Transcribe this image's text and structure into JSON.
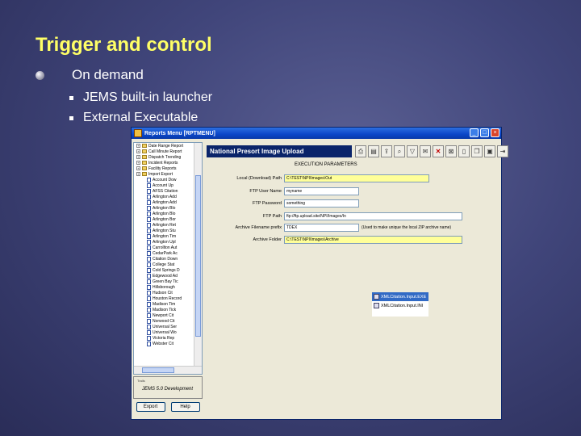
{
  "slide": {
    "title": "Trigger and control",
    "bullet": "On demand",
    "subbullets": [
      "JEMS built-in launcher",
      "External Executable"
    ]
  },
  "window": {
    "title": "Reports Menu [RPTMENU]",
    "tree_items": [
      {
        "label": "Date Range Report",
        "type": "folder"
      },
      {
        "label": "Call Minute Report",
        "type": "folder"
      },
      {
        "label": "Dispatch Trending",
        "type": "folder"
      },
      {
        "label": "Incident Reports",
        "type": "folder"
      },
      {
        "label": "Facility Reports",
        "type": "folder"
      },
      {
        "label": "Import Export",
        "type": "folder"
      },
      {
        "label": "Account Dow",
        "type": "doc"
      },
      {
        "label": "Account Up",
        "type": "doc"
      },
      {
        "label": "AFSS Citation",
        "type": "doc"
      },
      {
        "label": "Arlington Add",
        "type": "doc"
      },
      {
        "label": "Arlington Add",
        "type": "doc"
      },
      {
        "label": "Arlington Blo",
        "type": "doc"
      },
      {
        "label": "Arlington Blo",
        "type": "doc"
      },
      {
        "label": "Arlington Bor",
        "type": "doc"
      },
      {
        "label": "Arlington Ret",
        "type": "doc"
      },
      {
        "label": "Arlington Stu",
        "type": "doc"
      },
      {
        "label": "Arlington Tim",
        "type": "doc"
      },
      {
        "label": "Arlington Upl",
        "type": "doc"
      },
      {
        "label": "Carrollton Aut",
        "type": "doc"
      },
      {
        "label": "CedarPark Ac",
        "type": "doc"
      },
      {
        "label": "Citation Down",
        "type": "doc"
      },
      {
        "label": "College Stat",
        "type": "doc"
      },
      {
        "label": "Cold Springs D",
        "type": "doc"
      },
      {
        "label": "Edgewood Ad",
        "type": "doc"
      },
      {
        "label": "Green Bay Tic",
        "type": "doc"
      },
      {
        "label": "Hillsborough",
        "type": "doc"
      },
      {
        "label": "Hudson Cit",
        "type": "doc"
      },
      {
        "label": "Houston Record",
        "type": "doc"
      },
      {
        "label": "Madison Tim",
        "type": "doc"
      },
      {
        "label": "Madison Tick",
        "type": "doc"
      },
      {
        "label": "Newport Cit",
        "type": "doc"
      },
      {
        "label": "Norwood Cit",
        "type": "doc"
      },
      {
        "label": "Universal Ser",
        "type": "doc"
      },
      {
        "label": "Universal Wo",
        "type": "doc"
      },
      {
        "label": "Victoria Rep",
        "type": "doc"
      },
      {
        "label": "Webster Cit",
        "type": "doc"
      }
    ],
    "info_small": "Trails",
    "version": "JEMS 5.0 Development",
    "left_buttons": [
      "Export",
      "Help"
    ],
    "header": "National Presort Image Upload",
    "toolbar_icons": [
      "printer-icon",
      "preview-icon",
      "export-icon",
      "search-icon",
      "filter-icon",
      "email-icon",
      "delete-icon",
      "close-icon",
      "new-doc-icon",
      "copy-icon",
      "save-icon",
      "exit-icon"
    ],
    "section_title": "EXECUTION PARAMETERS",
    "fields": [
      {
        "label": "Local (Download) Path",
        "value": "C:\\TEST\\NPI\\Images\\Out",
        "color": "yellow",
        "note": ""
      },
      {
        "label": "FTP User Name",
        "value": "myname",
        "color": "white",
        "note": ""
      },
      {
        "label": "FTP Password",
        "value": "something",
        "color": "white",
        "note": ""
      },
      {
        "label": "FTP Path",
        "value": "ftp://ftp.upload.site/NPI/Images/In",
        "color": "white",
        "note": ""
      },
      {
        "label": "Archive Filename prefix",
        "value": "TDEX",
        "color": "white",
        "note": "(Used to make unique the local ZIP archive name)"
      },
      {
        "label": "Archive Folder",
        "value": "C:\\TEST\\NPI\\Images\\Archive",
        "color": "yellow",
        "note": ""
      }
    ],
    "files": [
      "XMLCitation.Input.EXE",
      "XMLCitation.Input.INI"
    ]
  }
}
